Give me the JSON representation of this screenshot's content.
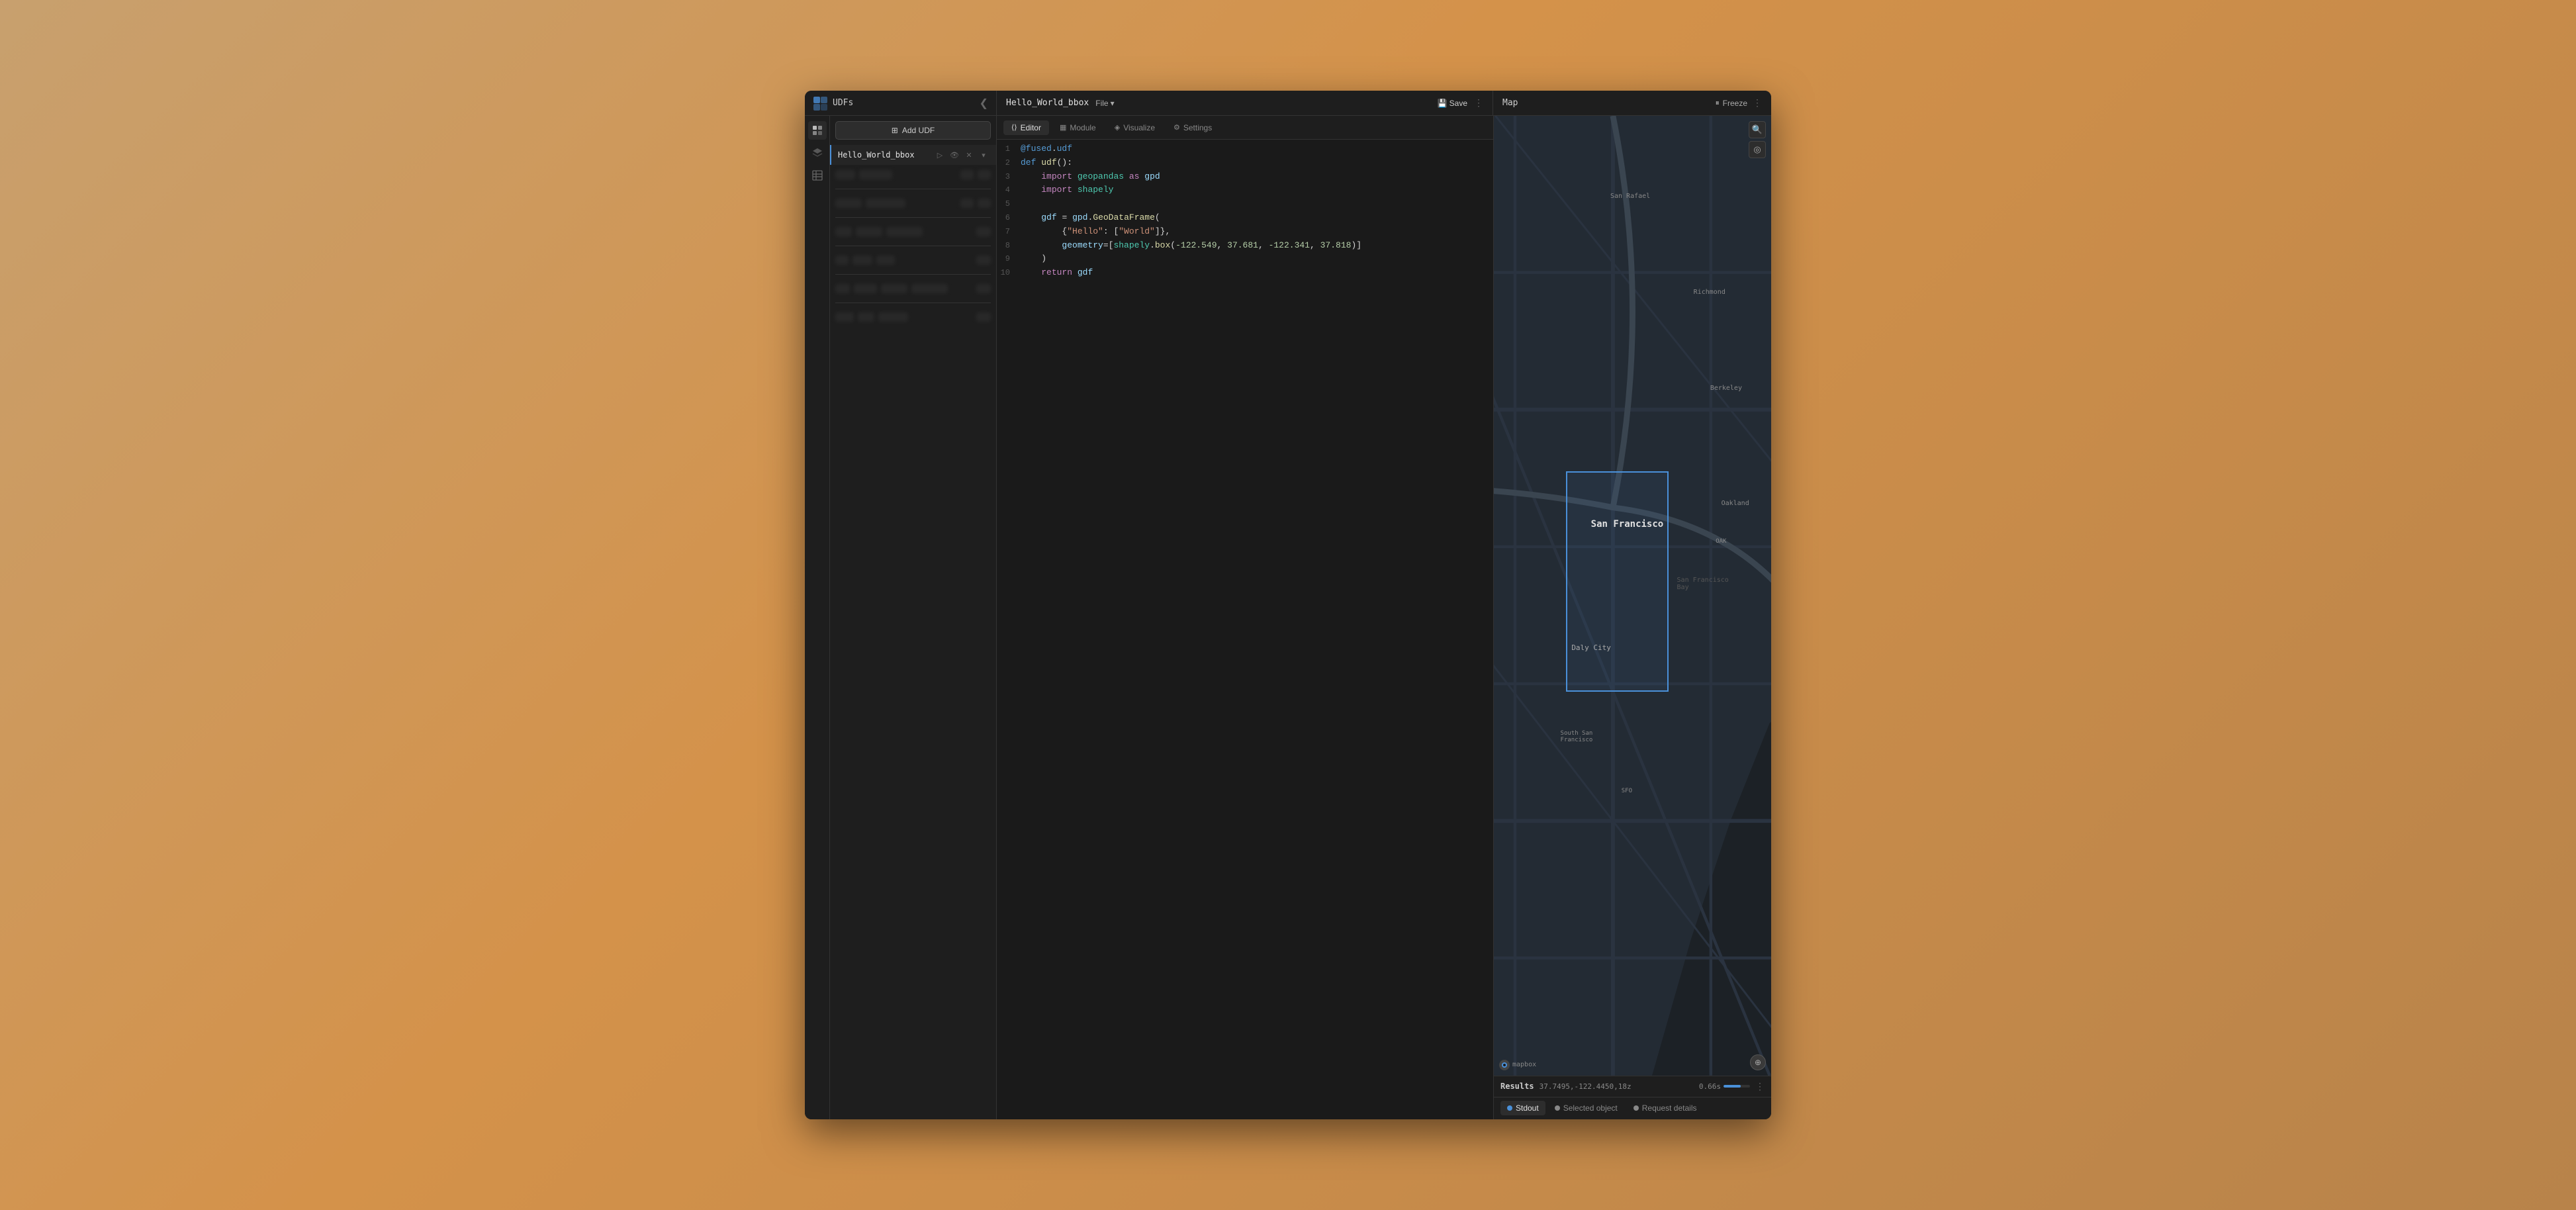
{
  "topbar": {
    "logo_alt": "fused-logo",
    "udfs_title": "UDFs",
    "collapse_icon": "❮",
    "file_tab": "Hello_World_bbox",
    "file_btn": "File",
    "file_chevron": "▾",
    "save_btn": "Save",
    "freeze_btn": "Freeze",
    "pause_icon": "⏸",
    "more_icon": "⋮",
    "map_title": "Map"
  },
  "editor_tabs": [
    {
      "id": "editor",
      "label": "Editor",
      "icon": "⟨⟩",
      "active": true
    },
    {
      "id": "module",
      "label": "Module",
      "icon": "▦",
      "active": false
    },
    {
      "id": "visualize",
      "label": "Visualize",
      "icon": "◈",
      "active": false
    },
    {
      "id": "settings",
      "label": "Settings",
      "icon": "⚙",
      "active": false
    }
  ],
  "code": {
    "lines": [
      {
        "num": "1",
        "content": "@fused.udf"
      },
      {
        "num": "2",
        "content": "def udf():"
      },
      {
        "num": "3",
        "content": "    import geopandas as gpd"
      },
      {
        "num": "4",
        "content": "    import shapely"
      },
      {
        "num": "5",
        "content": ""
      },
      {
        "num": "6",
        "content": "    gdf = gpd.GeoDataFrame("
      },
      {
        "num": "7",
        "content": "        {\"Hello\": [\"World\"]},"
      },
      {
        "num": "8",
        "content": "        geometry=[shapely.box(-122.549, 37.681, -122.341, 37.818)]"
      },
      {
        "num": "9",
        "content": "    )"
      },
      {
        "num": "10",
        "content": "    return gdf"
      }
    ]
  },
  "udf_panel": {
    "add_btn": "Add UDF",
    "add_icon": "⊞",
    "active_udf": "Hello_World_bbox"
  },
  "map": {
    "selection_label_sf": "San Francisco",
    "selection_label_dc": "Daly City",
    "label_sanrafael": "San Rafael",
    "label_richmond": "Richmond",
    "label_berkeley": "Berkeley",
    "label_oakland": "Oakland",
    "label_southsf": "South San\nFrancisco",
    "label_sfbay": "San Francisco\nBay",
    "label_oak": "OAK",
    "label_sfo": "SFO",
    "mapbox_label": "mapbox"
  },
  "results": {
    "label": "Results",
    "coords": "37.7495,-122.4450,18z",
    "time": "0.66s",
    "progress": 66,
    "tabs": [
      {
        "id": "stdout",
        "label": "Stdout",
        "color": "#4a90d9",
        "active": true
      },
      {
        "id": "selected",
        "label": "Selected object",
        "color": "#888",
        "active": false
      },
      {
        "id": "request",
        "label": "Request details",
        "color": "#888",
        "active": false
      }
    ]
  }
}
